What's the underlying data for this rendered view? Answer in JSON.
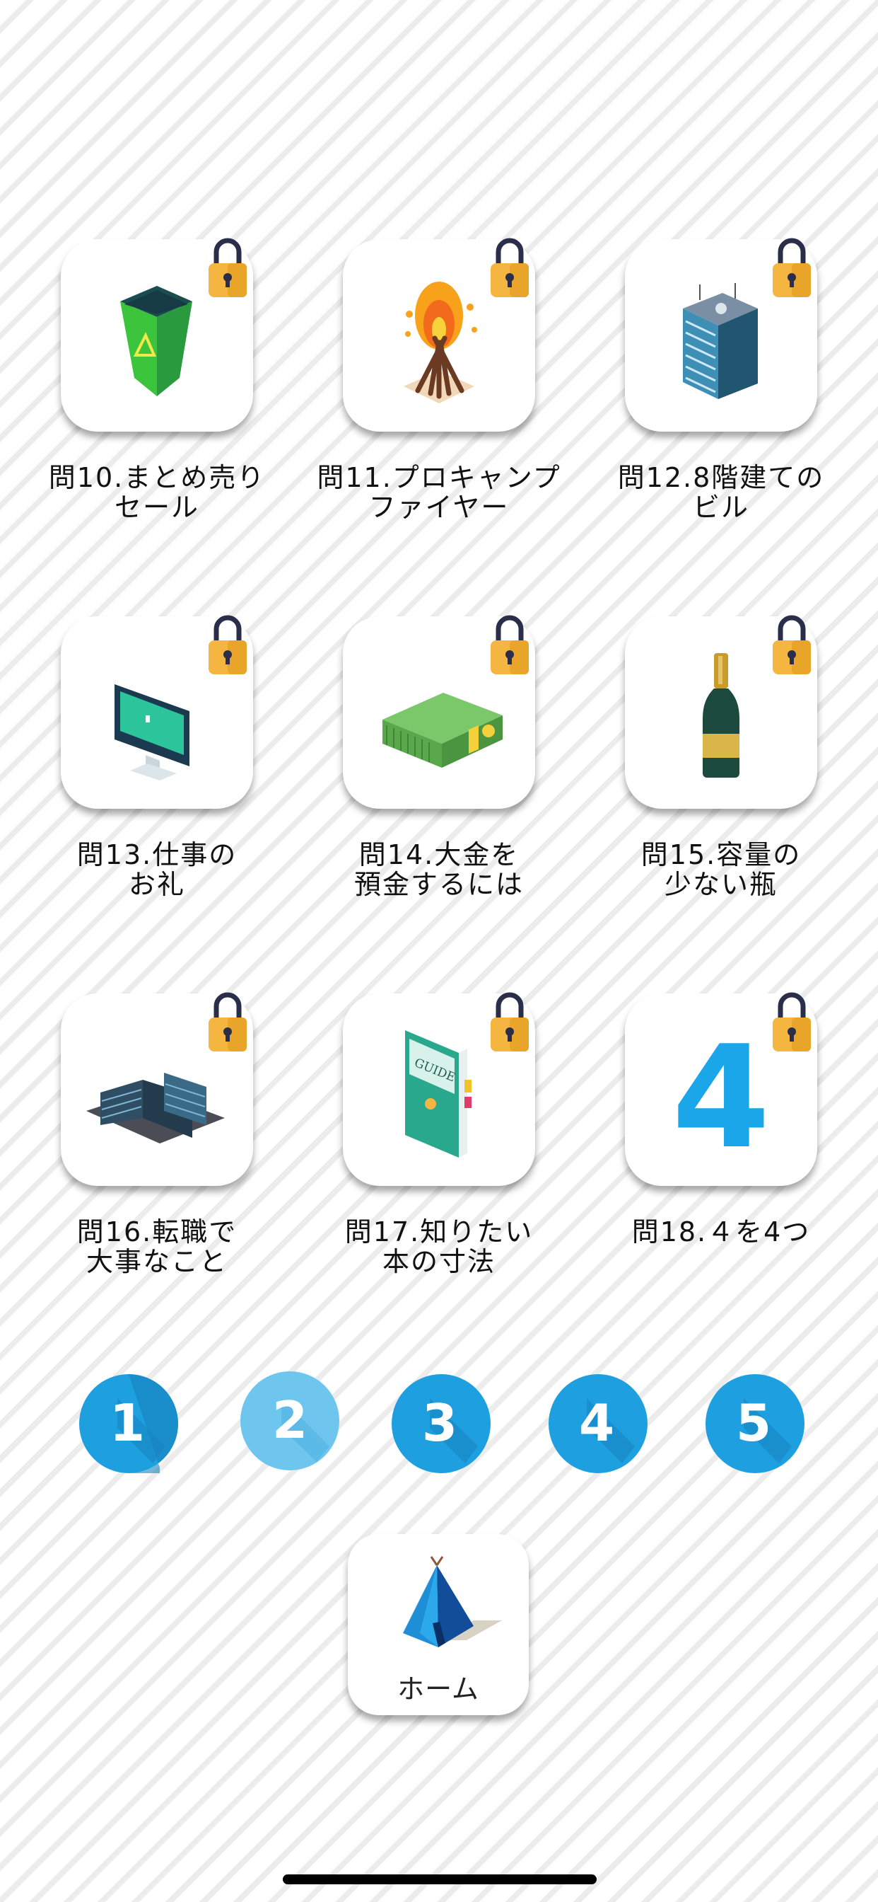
{
  "levels": [
    {
      "title_line1": "問10.まとめ売り",
      "title_line2": "セール",
      "icon": "recycle-bin-icon",
      "locked": true
    },
    {
      "title_line1": "問11.プロキャンプ",
      "title_line2": "ファイヤー",
      "icon": "campfire-icon",
      "locked": true
    },
    {
      "title_line1": "問12.8階建ての",
      "title_line2": "ビル",
      "icon": "office-building-icon",
      "locked": true
    },
    {
      "title_line1": "問13.仕事の",
      "title_line2": "お礼",
      "icon": "desktop-computer-icon",
      "locked": true
    },
    {
      "title_line1": "問14.大金を",
      "title_line2": "預金するには",
      "icon": "money-stack-icon",
      "locked": true
    },
    {
      "title_line1": "問15.容量の",
      "title_line2": "少ない瓶",
      "icon": "champagne-bottle-icon",
      "locked": true
    },
    {
      "title_line1": "問16.転職で",
      "title_line2": "大事なこと",
      "icon": "corporate-building-icon",
      "locked": true
    },
    {
      "title_line1": "問17.知りたい",
      "title_line2": "本の寸法",
      "icon": "guide-book-icon",
      "locked": true
    },
    {
      "title_line1": "問18.４を4つ",
      "title_line2": "",
      "icon": "number-four-icon",
      "locked": true
    }
  ],
  "tile_art": {
    "guide_text": "GUIDE",
    "four_text": "4"
  },
  "pager": {
    "pages": [
      "1",
      "2",
      "3",
      "4",
      "5"
    ],
    "current_page": "2"
  },
  "home": {
    "label": "ホーム",
    "icon": "tent-icon"
  },
  "colors": {
    "page_button": "#1e9fe0",
    "page_button_active": "#6ec6ee",
    "lock_body": "#f4b640",
    "lock_shackle": "#2b2e4a"
  }
}
